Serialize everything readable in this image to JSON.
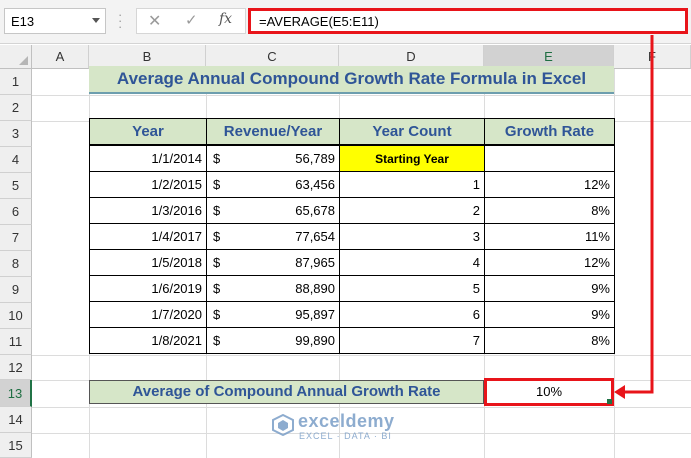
{
  "formula_bar": {
    "name_box": "E13",
    "formula": "=AVERAGE(E5:E11)",
    "cancel_glyph": "✕",
    "enter_glyph": "✓",
    "fx_label": "fx"
  },
  "columns": [
    "A",
    "B",
    "C",
    "D",
    "E",
    "F"
  ],
  "selected_column": "E",
  "rows": [
    "1",
    "2",
    "3",
    "4",
    "5",
    "6",
    "7",
    "8",
    "9",
    "10",
    "11",
    "12",
    "13",
    "14",
    "15"
  ],
  "selected_row": "13",
  "title": "Average Annual Compound Growth Rate Formula in Excel",
  "table": {
    "headers": [
      "Year",
      "Revenue/Year",
      "Year Count",
      "Growth Rate"
    ],
    "currency_symbol": "$",
    "rows": [
      {
        "year": "1/1/2014",
        "revenue": "56,789",
        "count": "Starting Year",
        "rate": ""
      },
      {
        "year": "1/2/2015",
        "revenue": "63,456",
        "count": "1",
        "rate": "12%"
      },
      {
        "year": "1/3/2016",
        "revenue": "65,678",
        "count": "2",
        "rate": "8%"
      },
      {
        "year": "1/4/2017",
        "revenue": "77,654",
        "count": "3",
        "rate": "11%"
      },
      {
        "year": "1/5/2018",
        "revenue": "87,965",
        "count": "4",
        "rate": "12%"
      },
      {
        "year": "1/6/2019",
        "revenue": "88,890",
        "count": "5",
        "rate": "9%"
      },
      {
        "year": "1/7/2020",
        "revenue": "95,897",
        "count": "6",
        "rate": "9%"
      },
      {
        "year": "1/8/2021",
        "revenue": "99,890",
        "count": "7",
        "rate": "8%"
      }
    ]
  },
  "summary": {
    "label": "Average of Compound Annual Growth Rate",
    "value": "10%"
  },
  "watermark": {
    "brand": "exceldemy",
    "tagline": "EXCEL · DATA · BI"
  },
  "colors": {
    "accent_red": "#e8141a",
    "header_fill": "#d6e6c8",
    "header_text": "#2f5597",
    "highlight_yellow": "#ffff00",
    "excel_green": "#217346"
  }
}
